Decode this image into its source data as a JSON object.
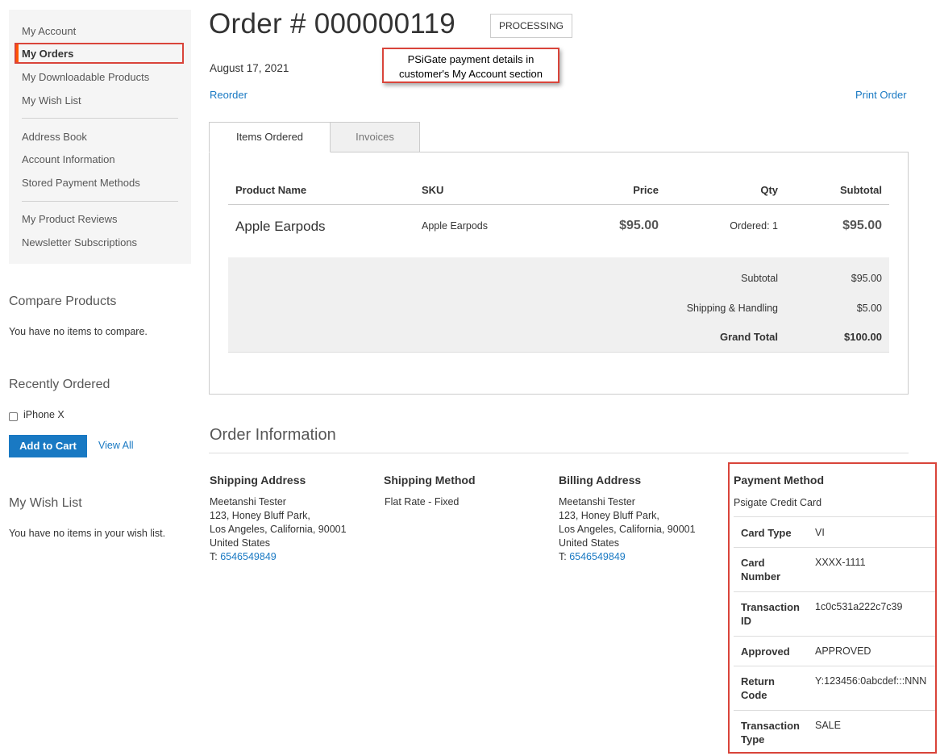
{
  "sidebar": {
    "items": [
      {
        "label": "My Account"
      },
      {
        "label": "My Orders"
      },
      {
        "label": "My Downloadable Products"
      },
      {
        "label": "My Wish List"
      },
      {
        "label": "Address Book"
      },
      {
        "label": "Account Information"
      },
      {
        "label": "Stored Payment Methods"
      },
      {
        "label": "My Product Reviews"
      },
      {
        "label": "Newsletter Subscriptions"
      }
    ],
    "compare": {
      "title": "Compare Products",
      "empty": "You have no items to compare."
    },
    "recent": {
      "title": "Recently Ordered",
      "item": "iPhone X",
      "add_to_cart": "Add to Cart",
      "view_all": "View All"
    },
    "wishlist": {
      "title": "My Wish List",
      "empty": "You have no items in your wish list."
    }
  },
  "order": {
    "title": "Order # 000000119",
    "status": "PROCESSING",
    "date": "August 17, 2021",
    "reorder": "Reorder",
    "print": "Print Order"
  },
  "callout": {
    "line1": "PSiGate payment details in",
    "line2": "customer's My Account section"
  },
  "tabs": [
    {
      "label": "Items Ordered"
    },
    {
      "label": "Invoices"
    }
  ],
  "items_table": {
    "headers": {
      "name": "Product Name",
      "sku": "SKU",
      "price": "Price",
      "qty": "Qty",
      "subtotal": "Subtotal"
    },
    "rows": [
      {
        "name": "Apple Earpods",
        "sku": "Apple Earpods",
        "price": "$95.00",
        "qty": "Ordered: 1",
        "subtotal": "$95.00"
      }
    ],
    "totals": [
      {
        "label": "Subtotal",
        "value": "$95.00"
      },
      {
        "label": "Shipping & Handling",
        "value": "$5.00"
      },
      {
        "label": "Grand Total",
        "value": "$100.00"
      }
    ]
  },
  "order_info": {
    "title": "Order Information",
    "shipping_address": {
      "title": "Shipping Address",
      "lines": [
        "Meetanshi Tester",
        "123, Honey Bluff Park,",
        "Los Angeles, California, 90001",
        "United States"
      ],
      "phone_prefix": "T: ",
      "phone": "6546549849"
    },
    "shipping_method": {
      "title": "Shipping Method",
      "value": "Flat Rate - Fixed"
    },
    "billing_address": {
      "title": "Billing Address",
      "lines": [
        "Meetanshi Tester",
        "123, Honey Bluff Park,",
        "Los Angeles, California, 90001",
        "United States"
      ],
      "phone_prefix": "T: ",
      "phone": "6546549849"
    },
    "payment_method": {
      "title": "Payment Method",
      "name": "Psigate Credit Card",
      "rows": [
        {
          "label": "Card Type",
          "value": "VI"
        },
        {
          "label": "Card Number",
          "value": "XXXX-1111"
        },
        {
          "label": "Transaction ID",
          "value": "1c0c531a222c7c39"
        },
        {
          "label": "Approved",
          "value": "APPROVED"
        },
        {
          "label": "Return Code",
          "value": "Y:123456:0abcdef:::NNN"
        },
        {
          "label": "Transaction Type",
          "value": "SALE"
        }
      ]
    }
  },
  "colors": {
    "link": "#1979c3",
    "highlight": "#d9443a",
    "active_bar": "#ff5501",
    "button": "#1979c3"
  }
}
